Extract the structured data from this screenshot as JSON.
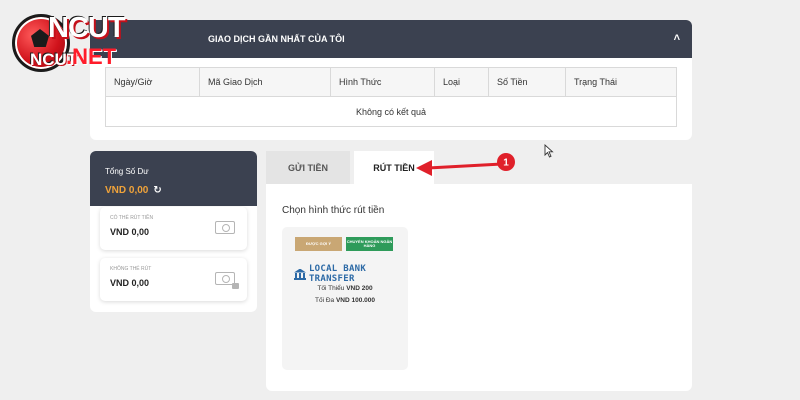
{
  "brand": {
    "logo_text": "NCUT",
    "logo_sub": "NCUT",
    "logo_domain": ".NET"
  },
  "transactions": {
    "header": "GIAO DỊCH GẦN NHẤT CỦA TÔI",
    "columns": [
      "Ngày/Giờ",
      "Mã Giao Dịch",
      "Hình Thức",
      "Loại",
      "Số Tiền",
      "Trạng Thái"
    ],
    "empty_text": "Không có kết quả"
  },
  "balance": {
    "title": "Tổng Số Dư",
    "amount": "VND  0,00",
    "withdrawable_label": "CÓ THỂ RÚT TIỀN",
    "withdrawable_value": "VND  0,00",
    "locked_label": "KHÔNG THỂ RÚT",
    "locked_value": "VND  0,00"
  },
  "tabs": {
    "deposit": "GỬI TIỀN",
    "withdraw": "RÚT TIỀN",
    "active": "withdraw"
  },
  "withdraw": {
    "title": "Chọn hình thức rút tiền",
    "method": {
      "badge_recommended": "ĐƯỢC GỢI Ý",
      "badge_bank": "CHUYỂN KHOẢN NGÂN HÀNG",
      "name": "LOCAL BANK TRANSFER",
      "min_label": "Tối Thiểu",
      "min_value": "VND 200",
      "max_label": "Tối Đa",
      "max_value": "VND 100.000"
    }
  },
  "annotation": {
    "step": "1",
    "color": "#e0202a"
  },
  "colors": {
    "header_dark": "#3b4150",
    "accent_orange": "#f0a33a",
    "bank_blue": "#2d6aa6",
    "badge_green": "#2e9b5a",
    "badge_gold": "#c9a774"
  }
}
